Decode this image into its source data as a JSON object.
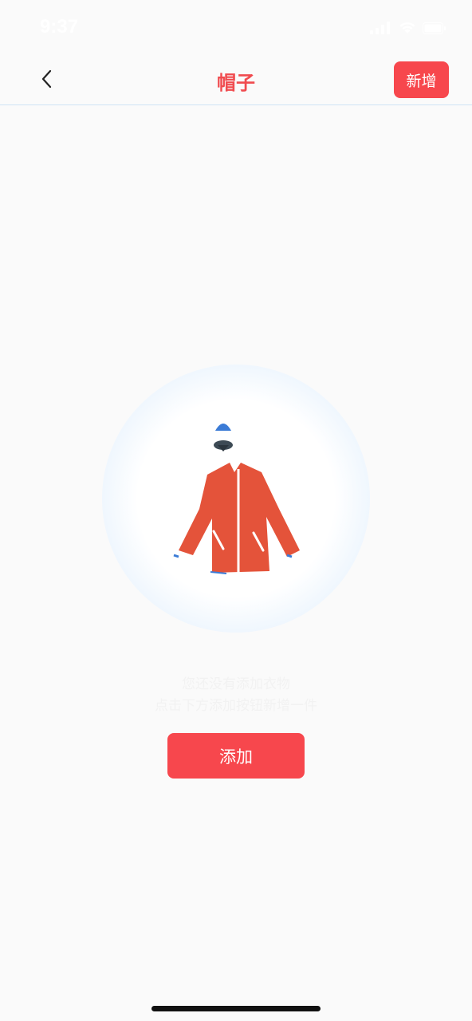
{
  "status_bar": {
    "time": "9:37",
    "icons": [
      "signal-icon",
      "wifi-icon",
      "battery-icon"
    ]
  },
  "nav": {
    "title": "帽子",
    "add_new_label": "新增",
    "back_icon": "chevron-left-icon"
  },
  "empty_state": {
    "illustration": "jacket-icon",
    "line1": "您还没有添加衣物",
    "line2": "点击下方添加按钮新增一件"
  },
  "actions": {
    "add_label": "添加"
  },
  "colors": {
    "accent": "#f7474d",
    "title": "#f04b4f",
    "background": "#fafafa",
    "circle_edge": "#c8e1f8"
  }
}
